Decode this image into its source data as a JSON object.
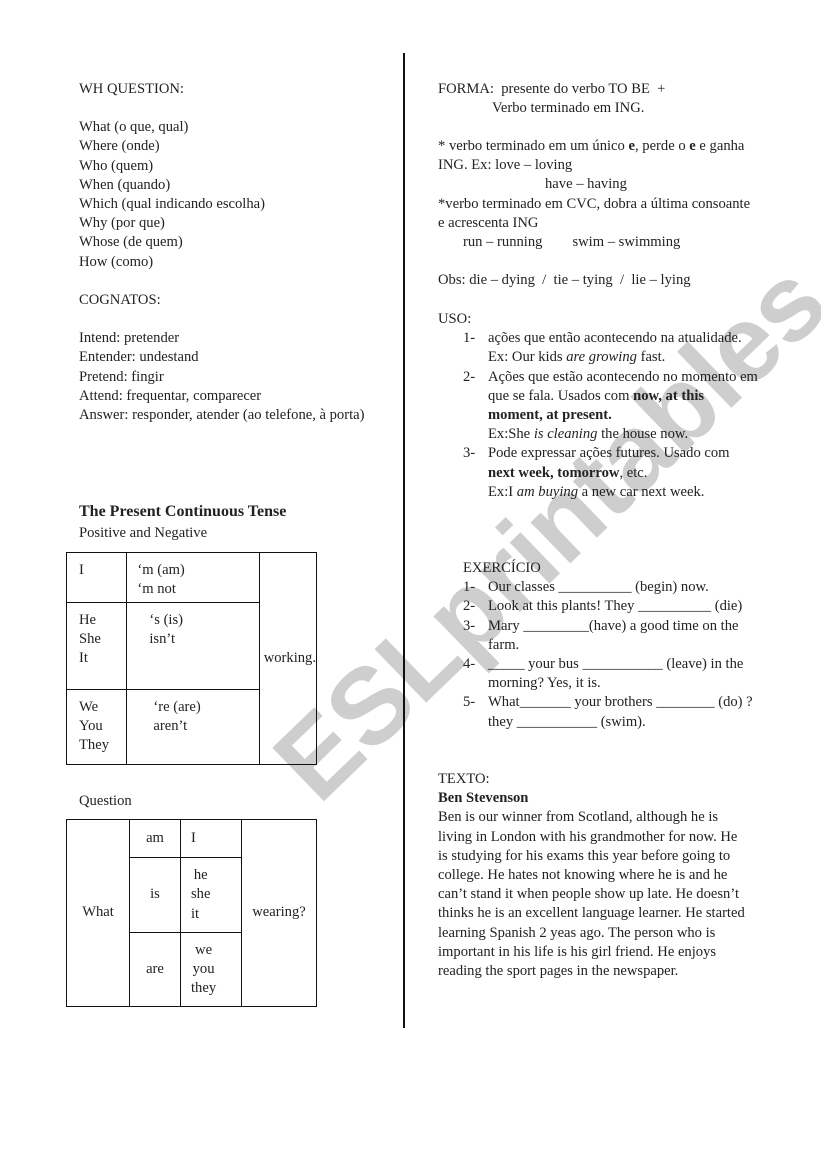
{
  "left": {
    "wh_question": {
      "heading": "WH QUESTION:",
      "items": [
        "What (o que, qual)",
        "Where (onde)",
        "Who (quem)",
        "When (quando)",
        "Which (qual indicando escolha)",
        "Why (por que)",
        "Whose (de quem)",
        "How (como)"
      ]
    },
    "cognatos": {
      "heading": "COGNATOS:",
      "items": [
        "Intend: pretender",
        "Entender: undestand",
        "Pretend: fingir",
        "Attend: frequentar, comparecer",
        "Answer: responder, atender (ao telefone, à porta)"
      ]
    },
    "present_continuous": {
      "title": "The Present Continuous Tense",
      "subtitle": "Positive and Negative",
      "table": {
        "rows": [
          {
            "subjects": [
              "I"
            ],
            "aux": [
              "‘m (am)",
              "‘m not"
            ]
          },
          {
            "subjects": [
              "He",
              "She",
              "It"
            ],
            "aux": [
              "‘s (is)",
              "isn’t"
            ]
          },
          {
            "subjects": [
              "We",
              "You",
              "They"
            ],
            "aux": [
              "‘re (are)",
              "aren’t"
            ]
          }
        ],
        "verb": "working."
      }
    },
    "question": {
      "label": "Question",
      "table": {
        "wh": "What",
        "rows": [
          {
            "aux": "am",
            "pronouns": [
              "I"
            ]
          },
          {
            "aux": "is",
            "pronouns": [
              "he",
              "she",
              "it"
            ]
          },
          {
            "aux": "are",
            "pronouns": [
              "we",
              "you",
              "they"
            ]
          }
        ],
        "verb": "wearing?"
      }
    }
  },
  "right": {
    "forma": {
      "line1": "FORMA:  presente do verbo TO BE  +",
      "line2": "Verbo terminado em ING."
    },
    "rules": {
      "rule1_a": "* verbo terminado em um único ",
      "rule1_b": "e",
      "rule1_c": ", perde o ",
      "rule1_d": "e",
      "rule1_e": " e ganha ING. Ex: love – loving",
      "rule1_example2": "have – having",
      "rule2": "*verbo terminado em CVC, dobra a última consoante e acrescenta ING",
      "rule2_example1": "run – running",
      "rule2_example2": "swim – swimming"
    },
    "obs": "Obs: die – dying  /  tie – tying  /  lie – lying",
    "uso": {
      "heading": "USO:",
      "items": [
        {
          "num": "1-",
          "t1": "ações que então acontecendo na atualidade. Ex: Our kids ",
          "t2_italic": "are growing",
          "t3": " fast."
        },
        {
          "num": "2-",
          "t1": "Ações que estão acontecendo no momento em que se fala. Usados com ",
          "t2_bold": "now, at this moment, at present.",
          "t3": "Ex:She ",
          "t4_italic": "is cleaning",
          "t5": " the house now."
        },
        {
          "num": "3-",
          "t1": "Pode expressar ações futures. Usado com ",
          "t2_bold": "next week, tomorrow",
          "t3": ", etc.",
          "t4": "Ex:I ",
          "t5_italic": "am buying",
          "t6": " a new car next week."
        }
      ]
    },
    "exercicio": {
      "heading": "EXERCÍCIO",
      "items": [
        {
          "num": "1-",
          "text": "Our classes __________ (begin) now."
        },
        {
          "num": "2-",
          "text": "Look at this plants! They __________ (die)"
        },
        {
          "num": "3-",
          "text": "Mary _________(have) a good time on the farm."
        },
        {
          "num": "4-",
          "text": "_____ your bus ___________ (leave) in the morning? Yes, it is."
        },
        {
          "num": "5-",
          "text": "What_______ your brothers ________ (do) ? they ___________ (swim)."
        }
      ]
    },
    "texto": {
      "heading": "TEXTO:",
      "title": "Ben Stevenson",
      "body": "Ben is our winner from Scotland, although he is living in London with his grandmother for now. He is studying for his exams this year before going to college. He hates not knowing where he is and he can’t stand it when people show up late. He doesn’t thinks he is an excellent language learner. He started learning Spanish 2 yeas ago. The person who is important in his life is his girl friend. He enjoys reading the sport pages in the newspaper."
    }
  },
  "watermark": "ESLprintables.com"
}
